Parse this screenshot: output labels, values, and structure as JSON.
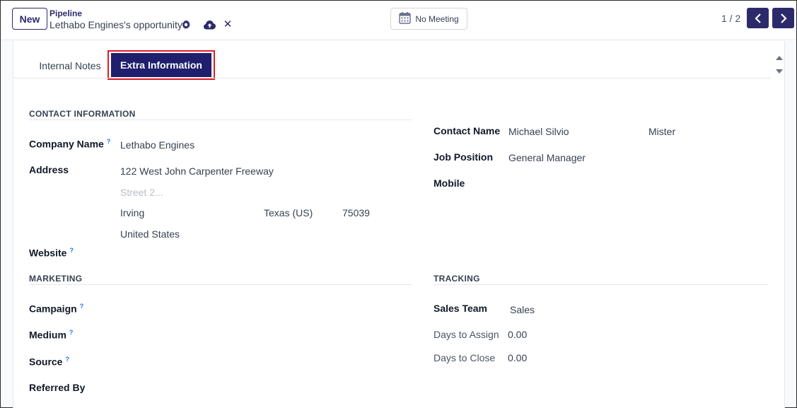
{
  "topbar": {
    "new_label": "New",
    "breadcrumb": "Pipeline",
    "record_title": "Lethabo Engines's opportunity",
    "meeting_label": "No Meeting",
    "pager": "1 / 2"
  },
  "tabs": {
    "notes": "Internal Notes",
    "extra": "Extra Information"
  },
  "contact": {
    "section": "CONTACT INFORMATION",
    "company_label": "Company Name",
    "company_value": "Lethabo Engines",
    "address_label": "Address",
    "street": "122 West John Carpenter Freeway",
    "street2_placeholder": "Street 2...",
    "city": "Irving",
    "state": "Texas (US)",
    "zip": "75039",
    "country": "United States",
    "website_label": "Website",
    "contact_name_label": "Contact Name",
    "contact_name_value": "Michael Silvio",
    "title_value": "Mister",
    "job_label": "Job Position",
    "job_value": "General Manager",
    "mobile_label": "Mobile"
  },
  "marketing": {
    "section": "MARKETING",
    "campaign_label": "Campaign",
    "medium_label": "Medium",
    "source_label": "Source",
    "referred_label": "Referred By"
  },
  "tracking": {
    "section": "TRACKING",
    "team_label": "Sales Team",
    "team_value": "Sales",
    "assign_label": "Days to Assign",
    "assign_value": "0.00",
    "close_label": "Days to Close",
    "close_value": "0.00"
  },
  "help_mark": "?",
  "colors": {
    "brand": "#2d2a6b",
    "active_tab": "#1f1f6e",
    "highlight": "#e11d24"
  }
}
